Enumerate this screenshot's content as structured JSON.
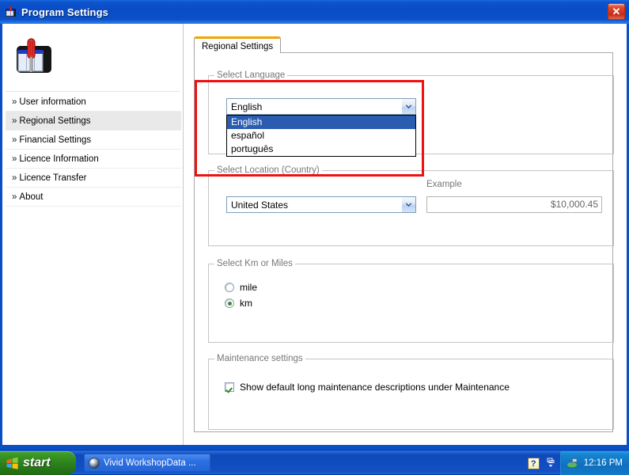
{
  "window": {
    "title": "Program Settings",
    "icon": "toolbox-screwdriver-icon",
    "close_label": "✕"
  },
  "sidebar": {
    "logo": "screwdriver-toolbox-logo",
    "items": [
      {
        "chevron": "»",
        "label": "User information",
        "selected": false
      },
      {
        "chevron": "»",
        "label": "Regional Settings",
        "selected": true
      },
      {
        "chevron": "»",
        "label": "Financial Settings",
        "selected": false
      },
      {
        "chevron": "»",
        "label": "Licence Information",
        "selected": false
      },
      {
        "chevron": "»",
        "label": "Licence Transfer",
        "selected": false
      },
      {
        "chevron": "»",
        "label": "About",
        "selected": false
      }
    ]
  },
  "main": {
    "tabs": [
      {
        "label": "Regional Settings",
        "active": true
      }
    ],
    "language_group": {
      "title": "Select Language",
      "combo_value": "English",
      "dropdown_open": true,
      "options": [
        {
          "label": "English",
          "selected": true
        },
        {
          "label": "español",
          "selected": false
        },
        {
          "label": "português",
          "selected": false
        }
      ]
    },
    "location_group": {
      "title": "Select Location (Country)",
      "combo_value": "United States",
      "example_label": "Example",
      "example_value": "$10,000.45"
    },
    "units_group": {
      "title": "Select Km or Miles",
      "options": [
        {
          "label": "mile",
          "selected": false
        },
        {
          "label": "km",
          "selected": true
        }
      ]
    },
    "maintenance_group": {
      "title": "Maintenance settings",
      "checkbox_label": "Show default long maintenance descriptions under Maintenance",
      "checked": true
    }
  },
  "annotation": {
    "color": "#ee1111"
  },
  "taskbar": {
    "start_label": "start",
    "tasks": [
      {
        "label": "Vivid WorkshopData ...",
        "icon": "app-disc-icon"
      }
    ],
    "tray": {
      "help_icon_label": "?",
      "overflow_icon": "▾",
      "app_icon": "network-tray-icon",
      "clock": "12:16 PM"
    }
  },
  "colors": {
    "title_bar": "#0A4FC4",
    "accent_tab": "#f2a400",
    "annotation": "#ee1111",
    "selection": "#2a5db0",
    "start_green": "#399524"
  }
}
